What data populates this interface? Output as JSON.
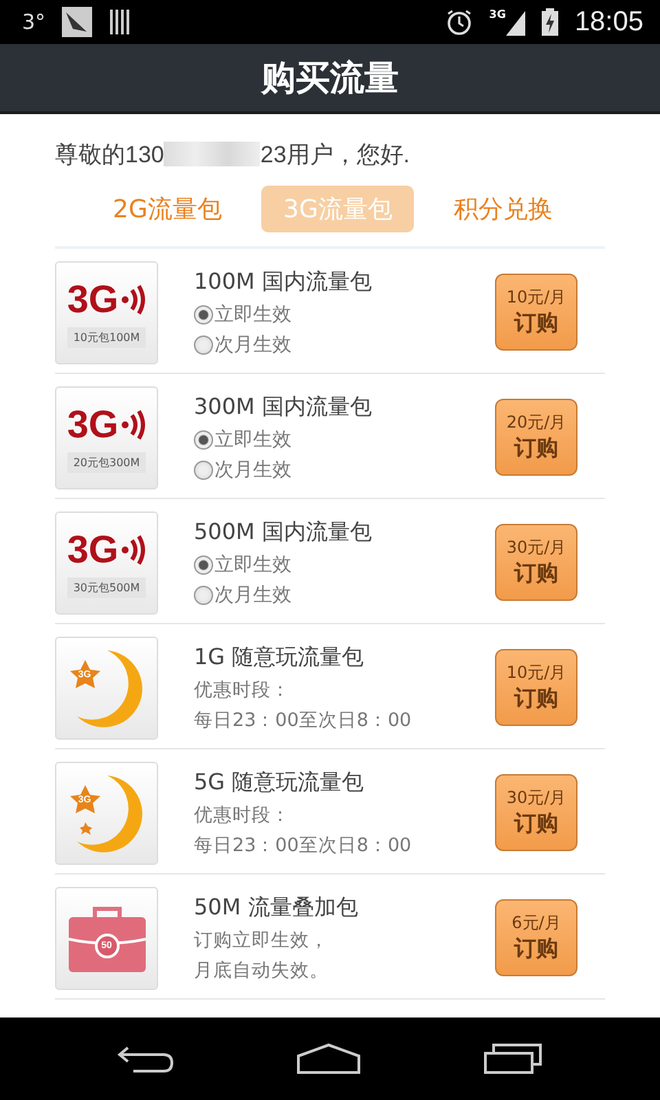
{
  "status_bar": {
    "temperature": "3°",
    "network": "3G",
    "time": "18:05"
  },
  "title": "购买流量",
  "greeting": {
    "prefix": "尊敬的130",
    "suffix": "23用户，您好."
  },
  "tabs": [
    {
      "label": "2G流量包",
      "selected": false
    },
    {
      "label": "3G流量包",
      "selected": true
    },
    {
      "label": "积分兑换",
      "selected": false
    }
  ],
  "packages": [
    {
      "kind": "signal",
      "icon_label": "3G",
      "icon_caption": "10元包100M",
      "name": "100M 国内流量包",
      "options": [
        {
          "label": "立即生效",
          "selected": true
        },
        {
          "label": "次月生效",
          "selected": false
        }
      ],
      "price": "10元/月",
      "action": "订购"
    },
    {
      "kind": "signal",
      "icon_label": "3G",
      "icon_caption": "20元包300M",
      "name": "300M 国内流量包",
      "options": [
        {
          "label": "立即生效",
          "selected": true
        },
        {
          "label": "次月生效",
          "selected": false
        }
      ],
      "price": "20元/月",
      "action": "订购"
    },
    {
      "kind": "signal",
      "icon_label": "3G",
      "icon_caption": "30元包500M",
      "name": "500M 国内流量包",
      "options": [
        {
          "label": "立即生效",
          "selected": true
        },
        {
          "label": "次月生效",
          "selected": false
        }
      ],
      "price": "30元/月",
      "action": "订购"
    },
    {
      "kind": "moon",
      "icon_label": "3G",
      "name": "1G 随意玩流量包",
      "lines": [
        "优惠时段：",
        "每日23：00至次日8：00"
      ],
      "price": "10元/月",
      "action": "订购"
    },
    {
      "kind": "stars",
      "icon_label": "3G",
      "name": "5G 随意玩流量包",
      "lines": [
        "优惠时段：",
        "每日23：00至次日8：00"
      ],
      "price": "30元/月",
      "action": "订购"
    },
    {
      "kind": "bag",
      "icon_label": "50",
      "name": "50M 流量叠加包",
      "lines": [
        "订购立即生效，",
        "月底自动失效。"
      ],
      "price": "6元/月",
      "action": "订购"
    }
  ]
}
